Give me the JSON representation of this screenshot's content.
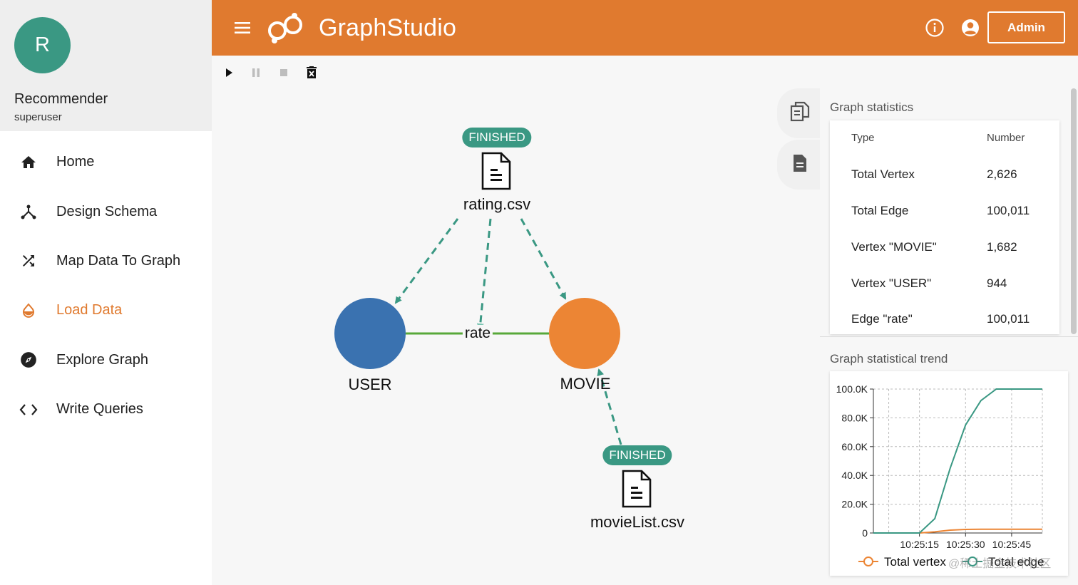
{
  "profile": {
    "initial": "R",
    "name": "Recommender",
    "role": "superuser"
  },
  "nav": {
    "items": [
      {
        "label": "Home",
        "icon": "home-icon"
      },
      {
        "label": "Design Schema",
        "icon": "schema-icon"
      },
      {
        "label": "Map Data To Graph",
        "icon": "shuffle-icon"
      },
      {
        "label": "Load Data",
        "icon": "water-drop-icon",
        "active": true
      },
      {
        "label": "Explore Graph",
        "icon": "compass-icon"
      },
      {
        "label": "Write Queries",
        "icon": "code-icon"
      }
    ]
  },
  "header": {
    "app_name": "GraphStudio",
    "admin_label": "Admin"
  },
  "colors": {
    "brand": "#e07a2f",
    "accent": "#3a9883",
    "user_node": "#3a72b0",
    "movie_node": "#ec8534",
    "edge": "#58a83a"
  },
  "graph": {
    "files": [
      {
        "name": "rating.csv",
        "status": "FINISHED"
      },
      {
        "name": "movieList.csv",
        "status": "FINISHED"
      }
    ],
    "vertices": [
      {
        "label": "USER"
      },
      {
        "label": "MOVIE"
      }
    ],
    "edges": [
      {
        "label": "rate"
      }
    ]
  },
  "stats": {
    "title": "Graph statistics",
    "col_type": "Type",
    "col_number": "Number",
    "rows": [
      {
        "type": "Total Vertex",
        "number": "2,626"
      },
      {
        "type": "Total Edge",
        "number": "100,011"
      },
      {
        "type": "Vertex \"MOVIE\"",
        "number": "1,682"
      },
      {
        "type": "Vertex \"USER\"",
        "number": "944"
      },
      {
        "type": "Edge \"rate\"",
        "number": "100,011"
      }
    ]
  },
  "trend": {
    "title": "Graph statistical trend",
    "chart_data": {
      "type": "line",
      "x": [
        0,
        5,
        10,
        15,
        20,
        25,
        30,
        35,
        40,
        45,
        50,
        55
      ],
      "x_ticks": [
        "10:25:15",
        "10:25:30",
        "10:25:45"
      ],
      "y_ticks": [
        "0",
        "20.0K",
        "40.0K",
        "60.0K",
        "80.0K",
        "100.0K"
      ],
      "ylim": [
        0,
        100000
      ],
      "series": [
        {
          "name": "Total vertex",
          "color": "#ec8534",
          "values": [
            0,
            0,
            0,
            0,
            800,
            2000,
            2500,
            2626,
            2626,
            2626,
            2626,
            2626
          ]
        },
        {
          "name": "Total edge",
          "color": "#3a9883",
          "values": [
            0,
            0,
            0,
            0,
            10000,
            45000,
            75000,
            92000,
            100011,
            100011,
            100011,
            100011
          ]
        }
      ]
    }
  },
  "watermark": "@稀土掘金技术社区"
}
